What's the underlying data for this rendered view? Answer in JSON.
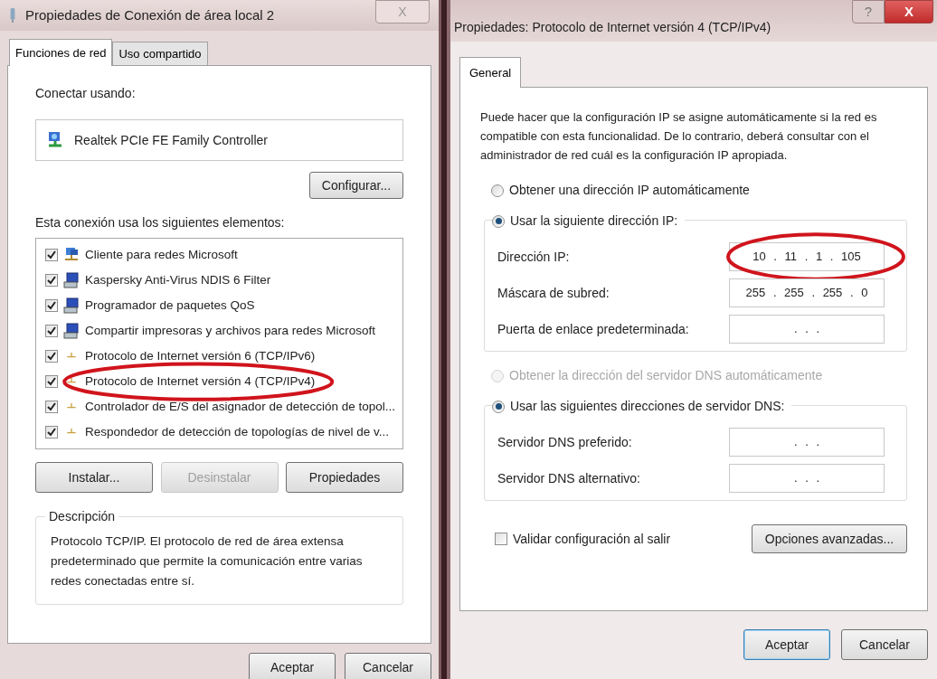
{
  "left_dialog": {
    "title": "Propiedades de Conexión de área local 2",
    "close_glyph": "X",
    "tabs": [
      {
        "label": "Funciones de red",
        "selected": true
      },
      {
        "label": "Uso compartido",
        "selected": false
      }
    ],
    "connect_label": "Conectar usando:",
    "adapter": "Realtek PCIe FE Family Controller",
    "configure_button": "Configurar...",
    "items_label": "Esta conexión usa los siguientes elementos:",
    "items": [
      {
        "kind": "client",
        "label": "Cliente para redes Microsoft",
        "checked": true,
        "circled": false
      },
      {
        "kind": "service",
        "label": "Kaspersky Anti-Virus NDIS 6 Filter",
        "checked": true,
        "circled": false
      },
      {
        "kind": "service",
        "label": "Programador de paquetes QoS",
        "checked": true,
        "circled": false
      },
      {
        "kind": "service",
        "label": "Compartir impresoras y archivos para redes Microsoft",
        "checked": true,
        "circled": false
      },
      {
        "kind": "protocol",
        "label": "Protocolo de Internet versión 6 (TCP/IPv6)",
        "checked": true,
        "circled": false
      },
      {
        "kind": "protocol",
        "label": "Protocolo de Internet versión 4 (TCP/IPv4)",
        "checked": true,
        "circled": true
      },
      {
        "kind": "protocol",
        "label": "Controlador de E/S del asignador de detección de topol...",
        "checked": true,
        "circled": false
      },
      {
        "kind": "protocol",
        "label": "Respondedor de detección de topologías de nivel de v...",
        "checked": true,
        "circled": false
      }
    ],
    "buttons": [
      {
        "label": "Instalar...",
        "disabled": false
      },
      {
        "label": "Desinstalar",
        "disabled": true
      },
      {
        "label": "Propiedades",
        "disabled": false
      }
    ],
    "description": {
      "title": "Descripción",
      "text": "Protocolo TCP/IP. El protocolo de red de área extensa predeterminado que permite la comunicación entre varias redes conectadas entre sí."
    },
    "footer_buttons": [
      {
        "label": "Aceptar",
        "default": false
      },
      {
        "label": "Cancelar",
        "default": false
      }
    ]
  },
  "right_dialog": {
    "title": "Propiedades: Protocolo de Internet versión 4 (TCP/IPv4)",
    "help_glyph": "?",
    "close_glyph": "X",
    "tabs": [
      {
        "label": "General",
        "selected": true
      }
    ],
    "intro": "Puede hacer que la configuración IP se asigne automáticamente si la red es compatible con esta funcionalidad. De lo contrario, deberá consultar con el administrador de red cuál es la configuración IP apropiada.",
    "ip_auto": {
      "label": "Obtener una dirección IP automáticamente",
      "selected": false,
      "disabled": false
    },
    "ip_manual": {
      "label": "Usar la siguiente dirección IP:",
      "selected": true,
      "disabled": false
    },
    "ip_fields": [
      {
        "label": "Dirección IP:",
        "value": "10 . 11 . 1 . 105",
        "circled": true
      },
      {
        "label": "Máscara de subred:",
        "value": "255 . 255 . 255 . 0",
        "circled": false
      },
      {
        "label": "Puerta de enlace predeterminada:",
        "value": ". . .",
        "circled": false
      }
    ],
    "dns_auto": {
      "label": "Obtener la dirección del servidor DNS automáticamente",
      "selected": false,
      "disabled": true
    },
    "dns_manual": {
      "label": "Usar las siguientes direcciones de servidor DNS:",
      "selected": true,
      "disabled": false
    },
    "dns_fields": [
      {
        "label": "Servidor DNS preferido:",
        "value": ". . .",
        "circled": false
      },
      {
        "label": "Servidor DNS alternativo:",
        "value": ". . .",
        "circled": false
      }
    ],
    "validate": {
      "label": "Validar configuración al salir",
      "checked": false
    },
    "advanced_button": "Opciones avanzadas...",
    "footer_buttons": [
      {
        "label": "Aceptar",
        "default": true
      },
      {
        "label": "Cancelar",
        "default": false
      }
    ]
  }
}
